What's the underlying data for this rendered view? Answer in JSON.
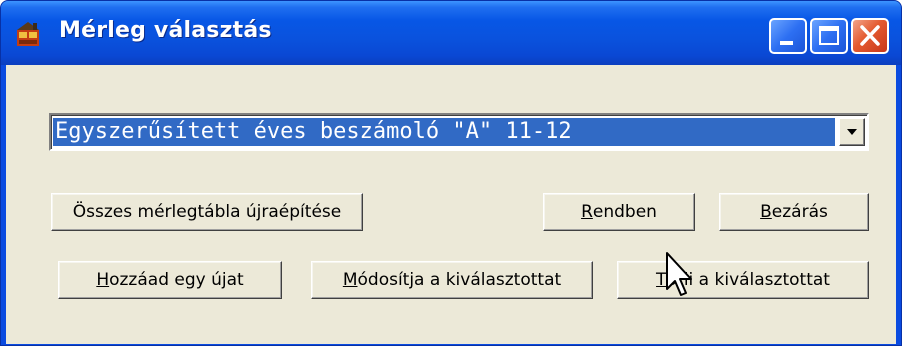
{
  "window": {
    "title": "Mérleg választás",
    "icon": "app-icon"
  },
  "title_buttons": {
    "minimize": "minimize-icon",
    "maximize": "maximize-icon",
    "close": "close-icon"
  },
  "combo": {
    "selected": "Egyszerűsített éves beszámoló \"A\" 11-12",
    "arrow_icon": "chevron-down-icon"
  },
  "buttons": {
    "rebuild": {
      "pre": "Összes mérlegtábla újraépítése",
      "key": "",
      "post": ""
    },
    "ok": {
      "pre": "",
      "key": "R",
      "post": "endben"
    },
    "close": {
      "pre": "",
      "key": "B",
      "post": "ezárás"
    },
    "add": {
      "pre": "",
      "key": "H",
      "post": "ozzáad egy újat"
    },
    "modify": {
      "pre": "",
      "key": "M",
      "post": "ódosítja a kiválasztottat"
    },
    "delete": {
      "pre": "",
      "key": "T",
      "post": "örli a kiválasztottat"
    }
  },
  "colors": {
    "titlebar": "#0a52dd",
    "selection": "#316ac5",
    "face": "#ece9d8",
    "close_button": "#e45a2f"
  }
}
